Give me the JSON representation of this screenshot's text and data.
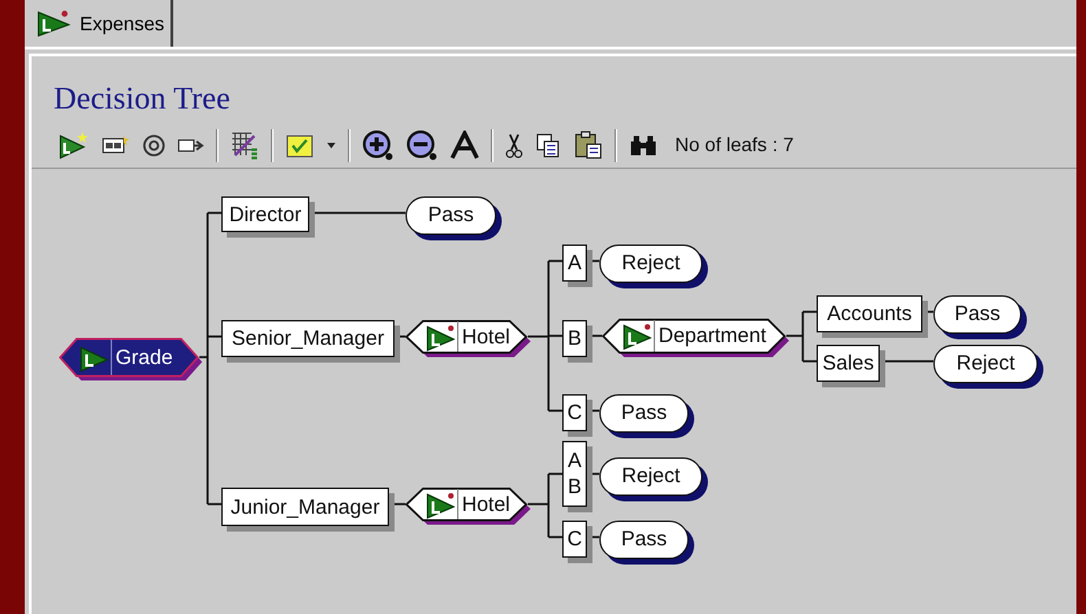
{
  "tabs": [
    {
      "label": "Expenses",
      "selected": true
    }
  ],
  "title": "Decision Tree",
  "toolbar": {
    "leaf_count": "No of leafs : 7"
  },
  "tree": {
    "kind": "variable",
    "label": "Grade",
    "selected": true,
    "children": [
      {
        "values": [
          "Director"
        ],
        "node": {
          "kind": "outcome",
          "label": "Pass"
        }
      },
      {
        "values": [
          "Senior_Manager"
        ],
        "node": {
          "kind": "variable",
          "label": "Hotel",
          "selected": false,
          "children": [
            {
              "values": [
                "A"
              ],
              "node": {
                "kind": "outcome",
                "label": "Reject"
              }
            },
            {
              "values": [
                "B"
              ],
              "node": {
                "kind": "variable",
                "label": "Department",
                "selected": false,
                "children": [
                  {
                    "values": [
                      "Accounts"
                    ],
                    "node": {
                      "kind": "outcome",
                      "label": "Pass"
                    }
                  },
                  {
                    "values": [
                      "Sales"
                    ],
                    "node": {
                      "kind": "outcome",
                      "label": "Reject"
                    }
                  }
                ]
              }
            },
            {
              "values": [
                "C"
              ],
              "node": {
                "kind": "outcome",
                "label": "Pass"
              }
            }
          ]
        }
      },
      {
        "values": [
          "Junior_Manager"
        ],
        "node": {
          "kind": "variable",
          "label": "Hotel",
          "selected": false,
          "children": [
            {
              "values": [
                "A",
                "B"
              ],
              "node": {
                "kind": "outcome",
                "label": "Reject"
              }
            },
            {
              "values": [
                "C"
              ],
              "node": {
                "kind": "outcome",
                "label": "Pass"
              }
            }
          ]
        }
      }
    ]
  }
}
